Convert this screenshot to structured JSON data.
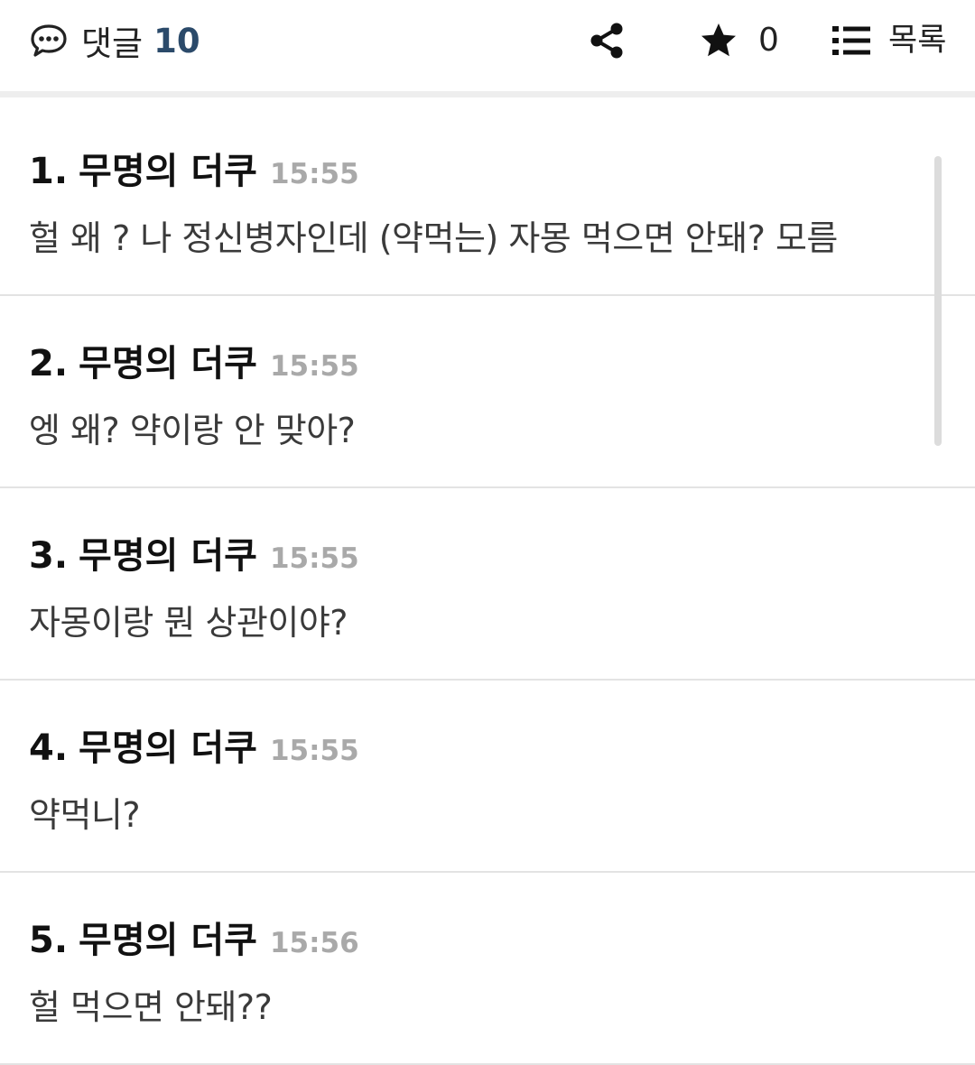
{
  "header": {
    "comments_label": "댓글",
    "comments_count": "10",
    "star_count": "0",
    "list_label": "목록"
  },
  "comments": [
    {
      "number": "1.",
      "author": "무명의 더쿠",
      "time": "15:55",
      "text": "헐 왜 ? 나 정신병자인데 (약먹는) 자몽 먹으면 안돼? 모름"
    },
    {
      "number": "2.",
      "author": "무명의 더쿠",
      "time": "15:55",
      "text": "엥 왜? 약이랑 안 맞아?"
    },
    {
      "number": "3.",
      "author": "무명의 더쿠",
      "time": "15:55",
      "text": "자몽이랑 뭔 상관이야?"
    },
    {
      "number": "4.",
      "author": "무명의 더쿠",
      "time": "15:55",
      "text": "약먹니?"
    },
    {
      "number": "5.",
      "author": "무명의 더쿠",
      "time": "15:56",
      "text": "헐 먹으면 안돼??"
    }
  ],
  "icons": {
    "comments": "speech-bubble-icon",
    "share": "share-icon",
    "star": "star-icon",
    "list": "list-icon"
  },
  "colors": {
    "count_accent": "#2b4a6a",
    "time_gray": "#a9a9a9"
  }
}
